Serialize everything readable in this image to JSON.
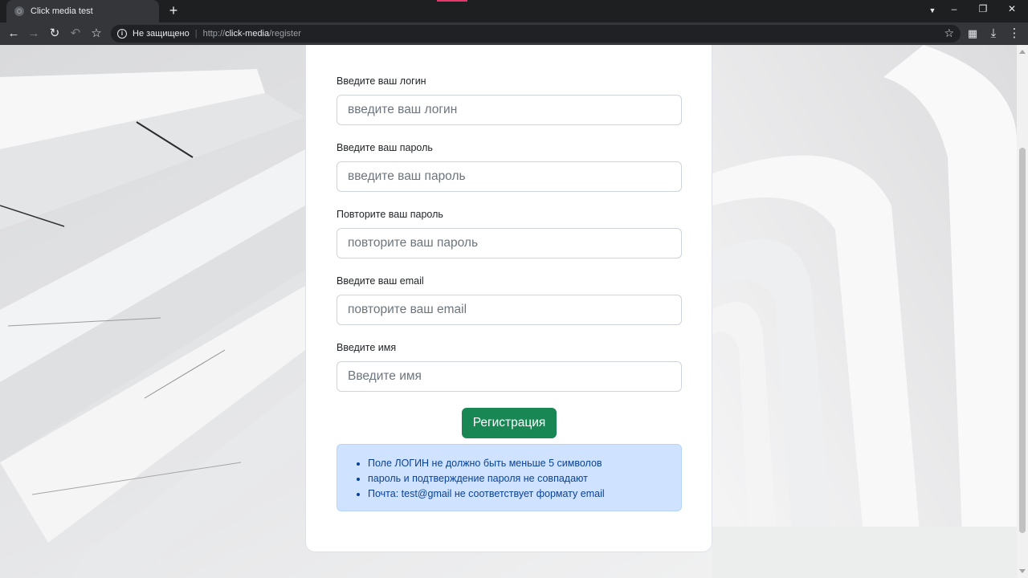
{
  "browser": {
    "tab_title": "Click media test",
    "new_tab": "+",
    "security_label": "Не защищено",
    "url_scheme": "http://",
    "url_host": "click-media",
    "url_path": "/register"
  },
  "form": {
    "fields": [
      {
        "label": "Введите ваш логин",
        "placeholder": "введите ваш логин"
      },
      {
        "label": "Введите ваш пароль",
        "placeholder": "введите ваш пароль"
      },
      {
        "label": "Повторите ваш пароль",
        "placeholder": "повторите ваш пароль"
      },
      {
        "label": "Введите ваш email",
        "placeholder": "повторите ваш email"
      },
      {
        "label": "Введите имя",
        "placeholder": "Введите имя"
      }
    ],
    "submit_label": "Регистрация",
    "errors": [
      "Поле ЛОГИН не должно быть меньше 5 символов",
      "пароль и подтверждение пароля не совпадают",
      "Почта: test@gmail не соответствует формату email"
    ]
  },
  "colors": {
    "submit_bg": "#198754",
    "alert_bg": "#cfe2ff",
    "alert_text": "#084298"
  }
}
